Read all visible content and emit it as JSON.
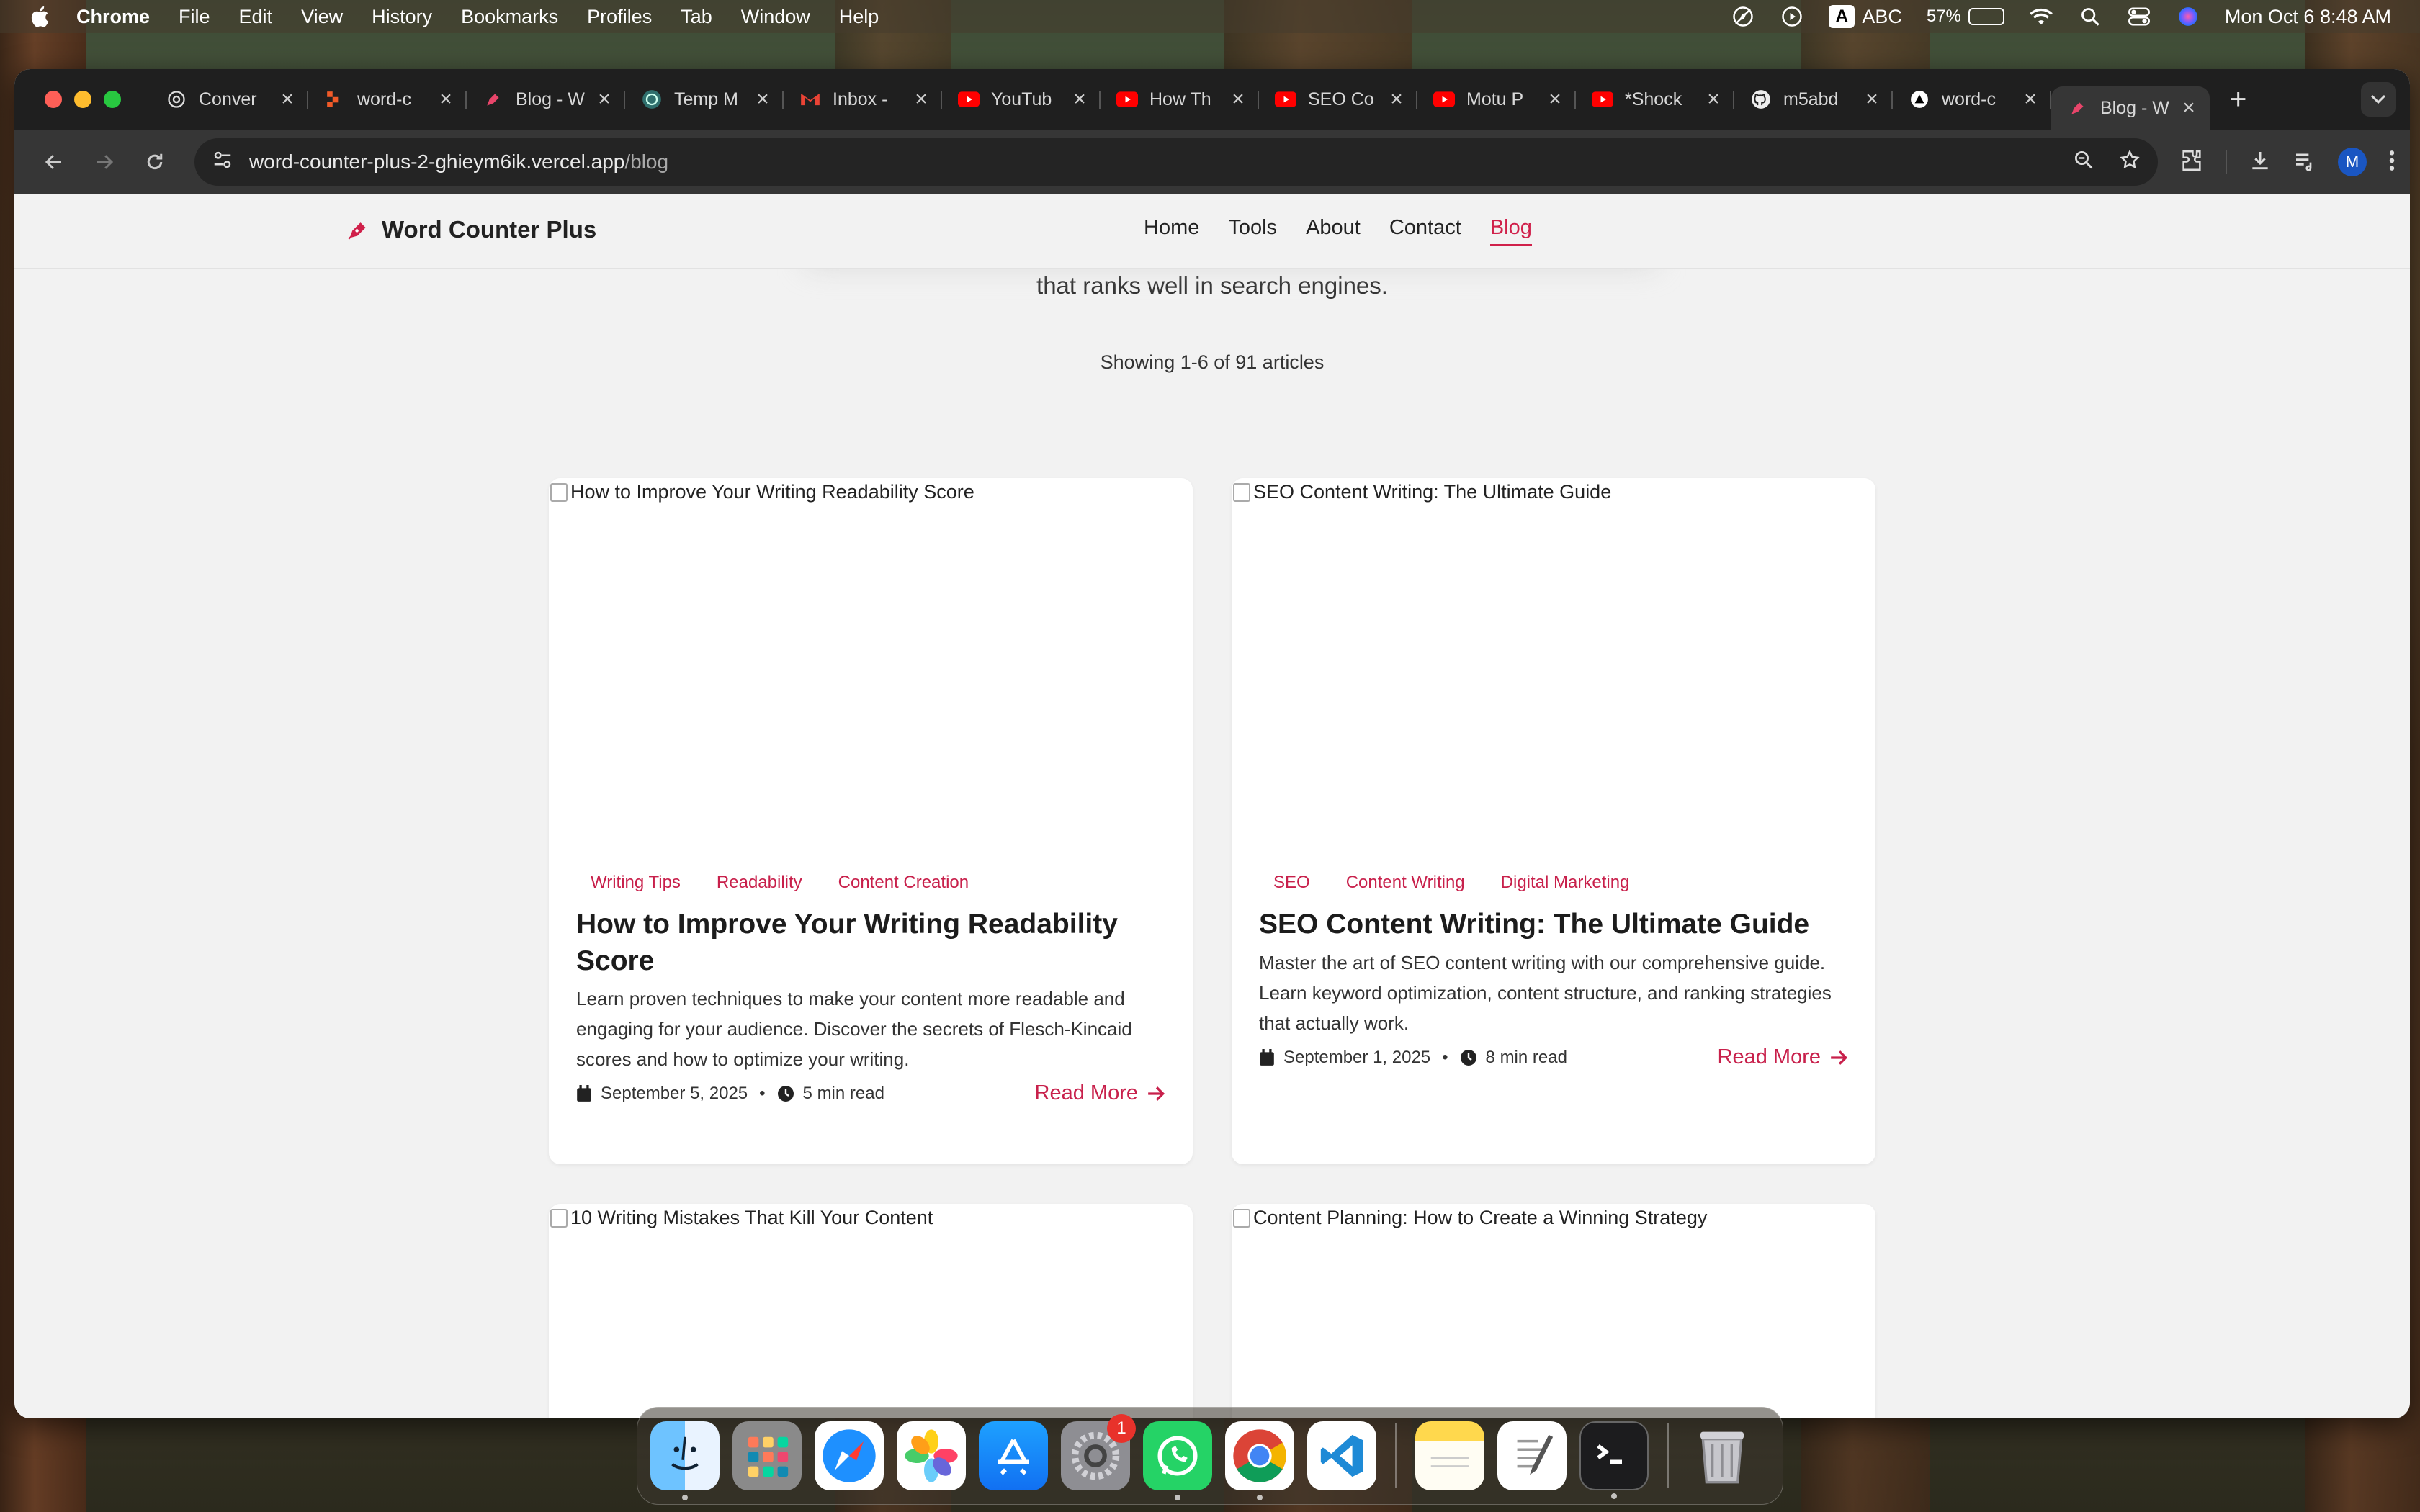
{
  "menubar": {
    "items": [
      "Chrome",
      "File",
      "Edit",
      "View",
      "History",
      "Bookmarks",
      "Profiles",
      "Tab",
      "Window",
      "Help"
    ],
    "input_source": "ABC",
    "input_letter": "A",
    "battery_percent": "57%",
    "battery_level": 0.57,
    "datetime": "Mon Oct 6  8:48 AM"
  },
  "tabs": [
    {
      "label": "Conver",
      "icon": "chatgpt-icon"
    },
    {
      "label": "word-c",
      "icon": "app-icon"
    },
    {
      "label": "Blog - W",
      "icon": "pen-icon"
    },
    {
      "label": "Temp M",
      "icon": "temp-mail-icon"
    },
    {
      "label": "Inbox - ",
      "icon": "gmail-icon"
    },
    {
      "label": "YouTub",
      "icon": "youtube-icon"
    },
    {
      "label": "How Th",
      "icon": "youtube-icon"
    },
    {
      "label": "SEO Co",
      "icon": "youtube-icon"
    },
    {
      "label": "Motu P",
      "icon": "youtube-icon"
    },
    {
      "label": "*Shock",
      "icon": "youtube-icon"
    },
    {
      "label": "m5abd",
      "icon": "github-icon"
    },
    {
      "label": "word-c",
      "icon": "vercel-icon"
    },
    {
      "label": "Blog - W",
      "icon": "pen-icon",
      "active": true
    }
  ],
  "address_bar": {
    "host": "word-counter-plus-2-ghieym6ik.vercel.app",
    "path": "/blog"
  },
  "profile_initial": "M",
  "site": {
    "brand": "Word Counter Plus",
    "nav": [
      "Home",
      "Tools",
      "About",
      "Contact",
      "Blog"
    ],
    "hero_tail": "that ranks well in search engines.",
    "showing": "Showing 1-6 of 91 articles",
    "accent": "#c8204b"
  },
  "articles": [
    {
      "image_alt": "How to Improve Your Writing Readability Score",
      "tags": [
        "Writing Tips",
        "Readability",
        "Content Creation"
      ],
      "title": "How to Improve Your Writing Readability Score",
      "description": "Learn proven techniques to make your content more readable and engaging for your audience. Discover the secrets of Flesch-Kincaid scores and how to optimize your writing.",
      "date": "September 5, 2025",
      "read_time": "5 min read",
      "read_more": "Read More"
    },
    {
      "image_alt": "SEO Content Writing: The Ultimate Guide",
      "tags": [
        "SEO",
        "Content Writing",
        "Digital Marketing"
      ],
      "title": "SEO Content Writing: The Ultimate Guide",
      "description": "Master the art of SEO content writing with our comprehensive guide. Learn keyword optimization, content structure, and ranking strategies that actually work.",
      "date": "September 1, 2025",
      "read_time": "8 min read",
      "read_more": "Read More"
    },
    {
      "image_alt": "10 Writing Mistakes That Kill Your Content"
    },
    {
      "image_alt": "Content Planning: How to Create a Winning Strategy"
    }
  ],
  "dock": {
    "apps": [
      "finder",
      "launchpad",
      "safari",
      "photos",
      "app-store",
      "system-settings",
      "whatsapp",
      "chrome",
      "vscode",
      "notes",
      "textedit",
      "terminal",
      "trash"
    ],
    "settings_badge": "1"
  }
}
